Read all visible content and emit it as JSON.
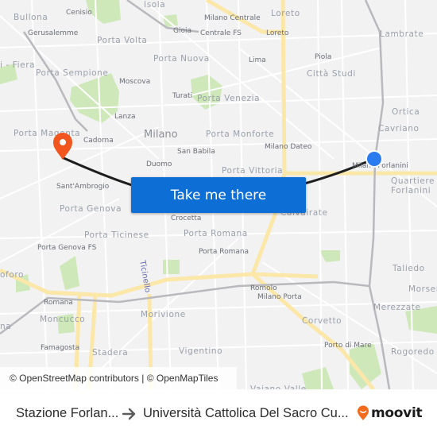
{
  "map": {
    "labels": {
      "cities": [
        {
          "id": "milano",
          "text": "Milano"
        }
      ],
      "districts": [
        {
          "id": "isola",
          "text": "Isola"
        },
        {
          "id": "bullona",
          "text": "Bullona"
        },
        {
          "id": "porta-volta",
          "text": "Porta Volta"
        },
        {
          "id": "loreto-d",
          "text": "Loreto"
        },
        {
          "id": "lambrate",
          "text": "Lambrate"
        },
        {
          "id": "fiera",
          "text": "i - Fiera"
        },
        {
          "id": "porta-nuova",
          "text": "Porta Nuova"
        },
        {
          "id": "porta-sempione",
          "text": "Porta Sempione"
        },
        {
          "id": "citta-studi",
          "text": "Città Studi"
        },
        {
          "id": "porta-venezia",
          "text": "Porta Venezia"
        },
        {
          "id": "ortica",
          "text": "Ortica"
        },
        {
          "id": "cavriano",
          "text": "Cavriano"
        },
        {
          "id": "porta-magenta",
          "text": "Porta Magenta"
        },
        {
          "id": "porta-monforte",
          "text": "Porta Monforte"
        },
        {
          "id": "porta-vittoria",
          "text": "Porta Vittoria"
        },
        {
          "id": "quartiere",
          "text": "Quartiere"
        },
        {
          "id": "forlanini",
          "text": "Forlanini"
        },
        {
          "id": "porta-genova",
          "text": "Porta Genova"
        },
        {
          "id": "calvairate",
          "text": "Calvairate"
        },
        {
          "id": "porta-ticinese",
          "text": "Porta Ticinese"
        },
        {
          "id": "porta-romana-d",
          "text": "Porta Romana"
        },
        {
          "id": "taliedo",
          "text": "Taliedo"
        },
        {
          "id": "foforo",
          "text": "oforo"
        },
        {
          "id": "morsen",
          "text": "Morsen"
        },
        {
          "id": "merezzate",
          "text": "Merezzate"
        },
        {
          "id": "moncucco",
          "text": "Moncucco"
        },
        {
          "id": "morivione",
          "text": "Morivione"
        },
        {
          "id": "corvetto",
          "text": "Corvetto"
        },
        {
          "id": "na",
          "text": "na"
        },
        {
          "id": "stadera",
          "text": "Stadera"
        },
        {
          "id": "vigentino",
          "text": "Vigentino"
        },
        {
          "id": "rogoredo",
          "text": "Rogoredo"
        },
        {
          "id": "vaiano-valle",
          "text": "Vaiano Valle"
        }
      ],
      "stations": [
        {
          "id": "cenisio",
          "text": "Cenisio"
        },
        {
          "id": "milano-centrale",
          "text": "Milano Centrale"
        },
        {
          "id": "gerusalemme",
          "text": "Gerusalemme"
        },
        {
          "id": "gioia",
          "text": "Gioia"
        },
        {
          "id": "centrale-fs",
          "text": "Centrale FS"
        },
        {
          "id": "loreto-s",
          "text": "Loreto"
        },
        {
          "id": "lima",
          "text": "Lima"
        },
        {
          "id": "piola",
          "text": "Piola"
        },
        {
          "id": "moscova",
          "text": "Moscova"
        },
        {
          "id": "turati",
          "text": "Turati"
        },
        {
          "id": "lanza",
          "text": "Lanza"
        },
        {
          "id": "cadorna",
          "text": "Cadorna"
        },
        {
          "id": "san-babila",
          "text": "San Babila"
        },
        {
          "id": "milano-dateo",
          "text": "Milano Dateo"
        },
        {
          "id": "duomo",
          "text": "Duomo"
        },
        {
          "id": "milano-forlanini",
          "text": "Milano Forlanini"
        },
        {
          "id": "santambrogio",
          "text": "Sant'Ambrogio"
        },
        {
          "id": "crocetta",
          "text": "Crocetta"
        },
        {
          "id": "porta-genova-fs",
          "text": "Porta Genova FS"
        },
        {
          "id": "porta-romana-s",
          "text": "Porta Romana"
        },
        {
          "id": "romolo",
          "text": "Romolo"
        },
        {
          "id": "milano-porta-romana-1",
          "text": "Milano Porta"
        },
        {
          "id": "milano-porta-romana-2",
          "text": "Romana"
        },
        {
          "id": "famagosta",
          "text": "Famagosta"
        },
        {
          "id": "porto-di-mare",
          "text": "Porto di Mare"
        }
      ],
      "streets": [
        {
          "id": "ticinello",
          "text": "Ticinello"
        }
      ]
    },
    "origin_marker": {
      "icon": "origin-dot-icon",
      "color": "#2a7bef"
    },
    "destination_marker": {
      "icon": "map-pin-icon",
      "color": "#f0561d"
    },
    "route_color": "#1e1e1e",
    "cta_label": "Take me there",
    "attribution": "© OpenStreetMap contributors | © OpenMapTiles"
  },
  "footer": {
    "from": "Stazione Forlan...",
    "arrow_icon": "arrow-right-icon",
    "to": "Università Cattolica Del Sacro Cu...",
    "brand": "moovit",
    "brand_color": "#f26b1d"
  }
}
